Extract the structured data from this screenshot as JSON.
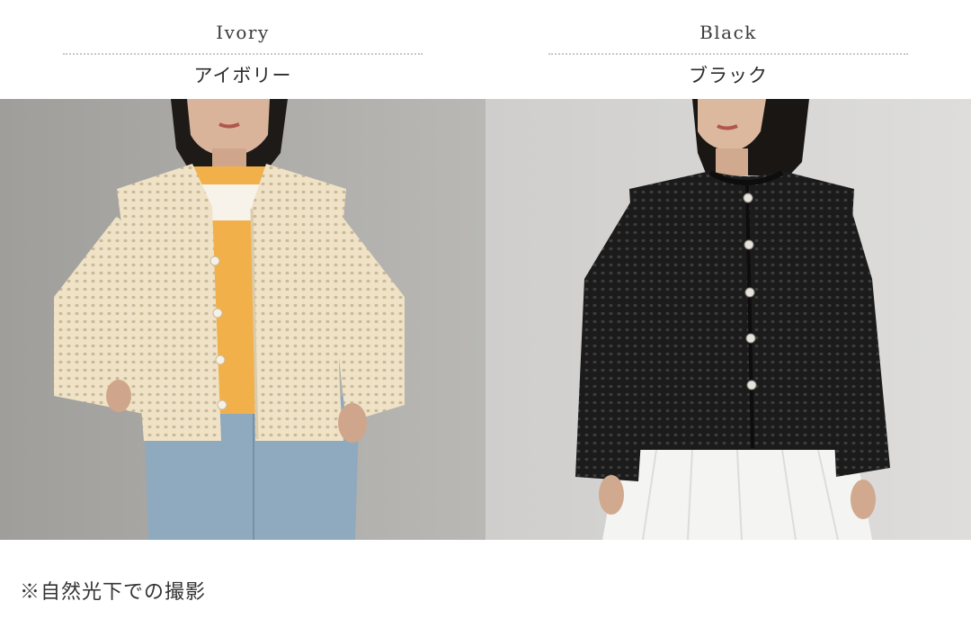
{
  "variants": [
    {
      "english": "Ivory",
      "japanese": "アイボリー"
    },
    {
      "english": "Black",
      "japanese": "ブラック"
    }
  ],
  "caption": "※自然光下での撮影",
  "colors": {
    "ivory_jacket": "#efe2c6",
    "black_jacket": "#1b1b1b",
    "orange_top": "#f2b04a",
    "denim": "#8fa9be",
    "white_skirt": "#f4f4f2"
  }
}
